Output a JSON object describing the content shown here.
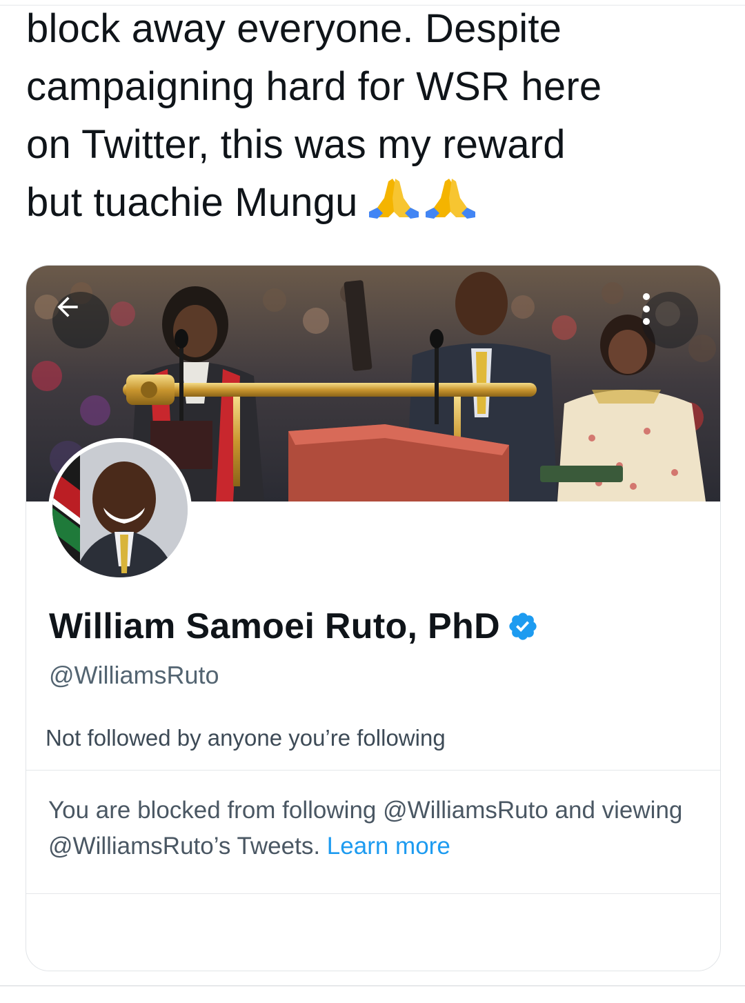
{
  "tweet": {
    "lines": [
      "block away everyone. Despite",
      "campaigning hard for WSR here",
      "on Twitter, this was my reward",
      "but tuachie Mungu"
    ],
    "emoji": [
      "folded-hands-emoji",
      "folded-hands-emoji"
    ]
  },
  "profile_card": {
    "display_name": "William Samoei Ruto, PhD",
    "verified": true,
    "handle": "@WilliamsRuto",
    "followers_note": "Not followed by anyone you’re following",
    "blocked_message": "You are blocked from following @WilliamsRuto and viewing @WilliamsRuto’s Tweets.",
    "learn_more_label": "Learn more",
    "header_icons": [
      "back-arrow-icon",
      "more-options-icon"
    ]
  },
  "colors": {
    "text_primary": "#0f1419",
    "text_secondary": "#536471",
    "link_blue": "#1d9bf0",
    "verified_blue": "#1d9bf0"
  }
}
